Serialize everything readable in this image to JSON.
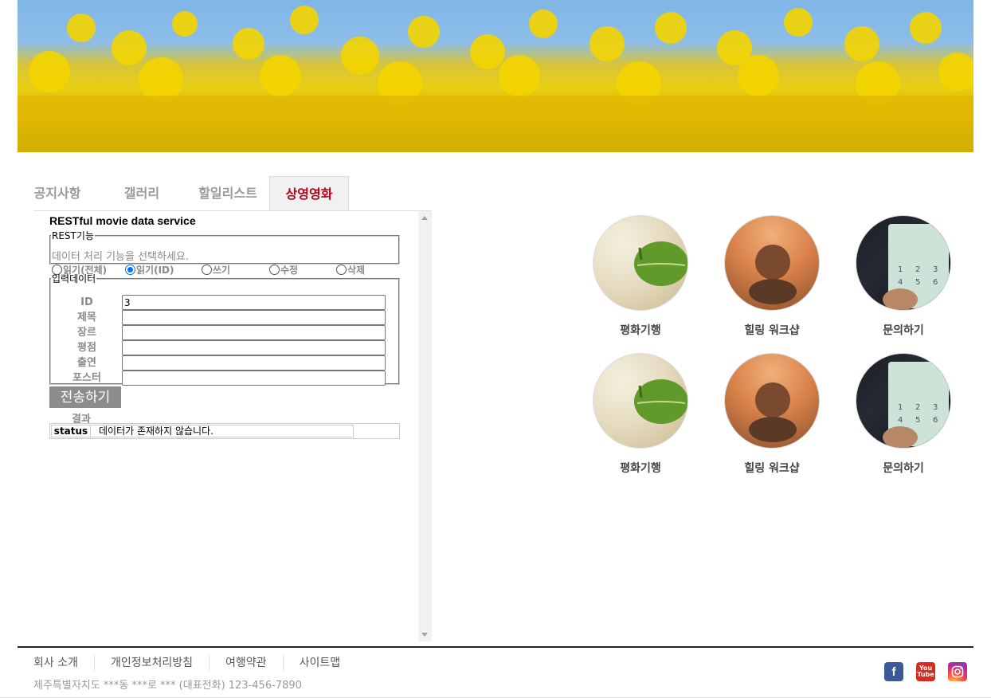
{
  "tabs": [
    {
      "label": "공지사항"
    },
    {
      "label": "갤러리"
    },
    {
      "label": "할일리스트"
    },
    {
      "label": "상영영화"
    }
  ],
  "service": {
    "title": "RESTful movie data service",
    "rest_legend": "REST기능",
    "hint": "데이터 처리 기능을 선택하세요.",
    "radios": [
      {
        "label": "읽기(전체)",
        "checked": false
      },
      {
        "label": "읽기(ID)",
        "checked": true
      },
      {
        "label": "쓰기",
        "checked": false
      },
      {
        "label": "수정",
        "checked": false
      },
      {
        "label": "삭제",
        "checked": false
      }
    ],
    "input_legend": "입력데이터",
    "fields": [
      {
        "label": "ID",
        "value": "3"
      },
      {
        "label": "제목",
        "value": ""
      },
      {
        "label": "장르",
        "value": ""
      },
      {
        "label": "평점",
        "value": ""
      },
      {
        "label": "출연",
        "value": ""
      },
      {
        "label": "포스터",
        "value": ""
      }
    ],
    "submit_label": "전송하기",
    "result_label": "결과",
    "result_key": "status",
    "result_value": "데이터가 존재하지 않습니다."
  },
  "gallery": [
    {
      "label": "평화기행",
      "image": "leaf-on-sand"
    },
    {
      "label": "힐링 워크샵",
      "image": "stacked-stones"
    },
    {
      "label": "문의하기",
      "image": "phone-keypad"
    },
    {
      "label": "평화기행",
      "image": "leaf-on-sand"
    },
    {
      "label": "힐링 워크샵",
      "image": "stacked-stones"
    },
    {
      "label": "문의하기",
      "image": "phone-keypad"
    }
  ],
  "footer": {
    "links": [
      "회사 소개",
      "개인정보처리방침",
      "여행약관",
      "사이트맵"
    ],
    "address": "제주특별자치도 ***동 ***로 *** (대표전화) 123-456-7890",
    "social": [
      "facebook-icon",
      "youtube-icon",
      "instagram-icon"
    ]
  }
}
